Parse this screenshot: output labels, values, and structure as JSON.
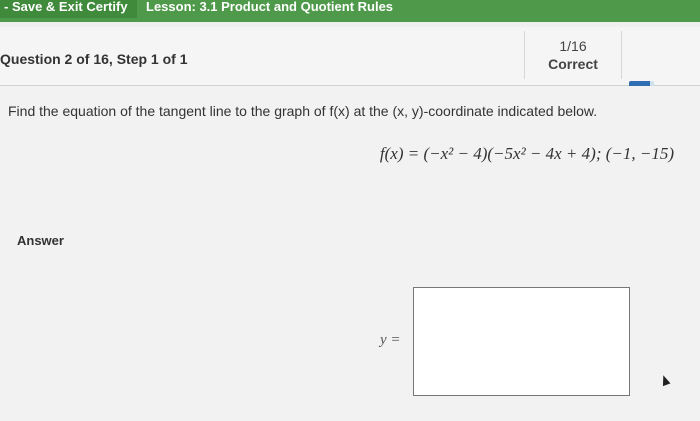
{
  "topbar": {
    "save_exit": "- Save & Exit Certify",
    "lesson": "Lesson: 3.1 Product and Quotient Rules"
  },
  "header": {
    "question_label": "Question 2 of 16, Step 1 of 1",
    "score_fraction": "1/16",
    "score_status": "Correct",
    "progress_fraction": 0.85
  },
  "question": {
    "prompt": "Find the equation of the tangent line to the graph of f(x) at the (x, y)-coordinate indicated below.",
    "equation": "f(x) = (−x² − 4)(−5x² − 4x + 4); (−1, −15)"
  },
  "answer": {
    "label": "Answer",
    "y_prefix": "y =",
    "value": ""
  },
  "colors": {
    "nav_green": "#4f9a4a",
    "progress_blue": "#2f6eb3"
  }
}
